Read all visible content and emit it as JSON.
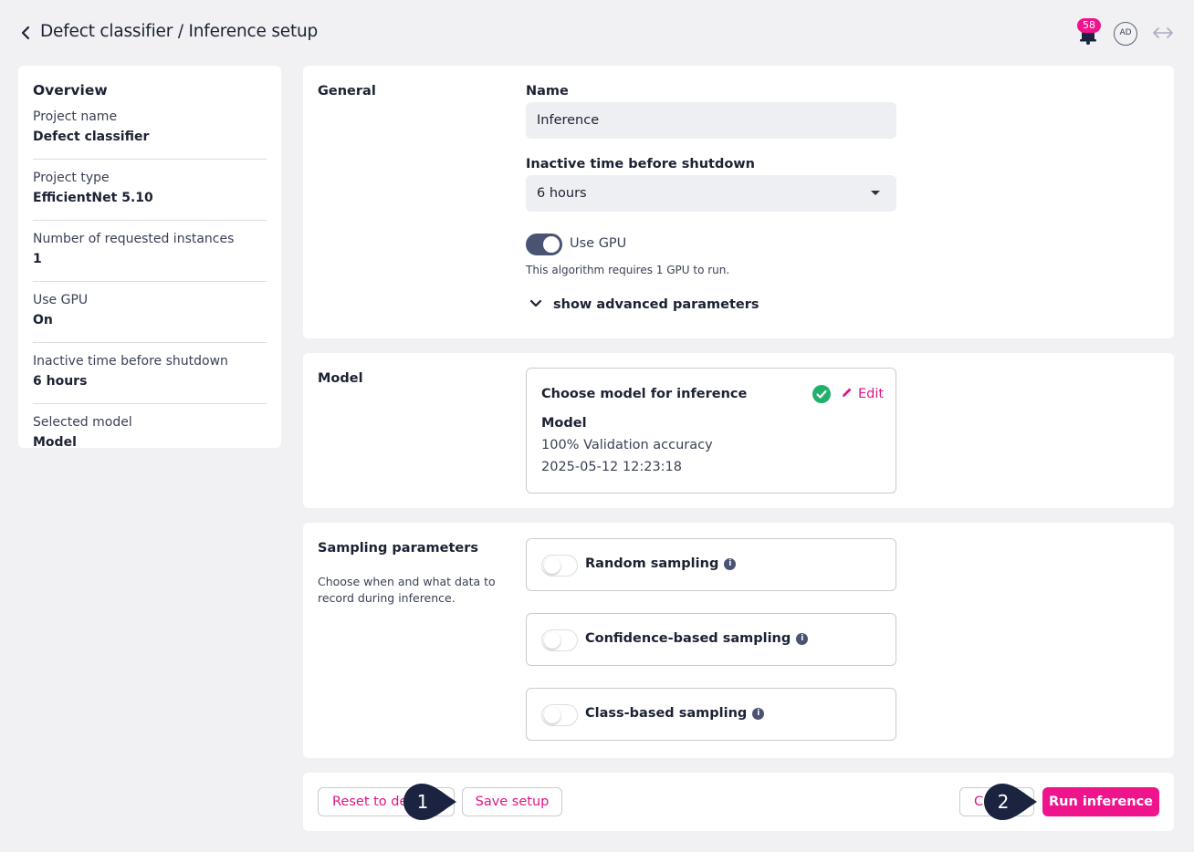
{
  "header": {
    "title": "Defect classifier / Inference setup",
    "notification_count": "58",
    "avatar_initials": "AD"
  },
  "overview": {
    "title": "Overview",
    "items": [
      {
        "label": "Project name",
        "value": "Defect classifier"
      },
      {
        "label": "Project type",
        "value": "EfficientNet 5.10"
      },
      {
        "label": "Number of requested instances",
        "value": "1"
      },
      {
        "label": "Use GPU",
        "value": "On"
      },
      {
        "label": "Inactive time before shutdown",
        "value": "6 hours"
      },
      {
        "label": "Selected model",
        "value": "Model"
      }
    ]
  },
  "general": {
    "section_label": "General",
    "name_label": "Name",
    "name_value": "Inference",
    "shutdown_label": "Inactive time before shutdown",
    "shutdown_value": "6 hours",
    "gpu_toggle_label": "Use GPU",
    "gpu_toggle_on": true,
    "gpu_note": "This algorithm requires 1 GPU to run.",
    "advanced_link": "show advanced parameters"
  },
  "model": {
    "section_label": "Model",
    "box_title": "Choose model for inference",
    "edit_label": "Edit",
    "model_name": "Model",
    "accuracy": "100% Validation accuracy",
    "timestamp": "2025-05-12 12:23:18"
  },
  "sampling": {
    "section_label": "Sampling parameters",
    "description": "Choose when and what data to record during inference.",
    "options": [
      {
        "label": "Random sampling",
        "enabled": false
      },
      {
        "label": "Confidence-based sampling",
        "enabled": false
      },
      {
        "label": "Class-based sampling",
        "enabled": false
      }
    ]
  },
  "footer": {
    "reset_label": "Reset to de",
    "save_label": "Save setup",
    "cancel_label": "C",
    "run_label": "Run inference",
    "marker_1": "1",
    "marker_2": "2"
  },
  "colors": {
    "accent": "#f0148c",
    "toggle_on": "#4a5472",
    "success": "#22b06b",
    "marker": "#1c2340"
  }
}
